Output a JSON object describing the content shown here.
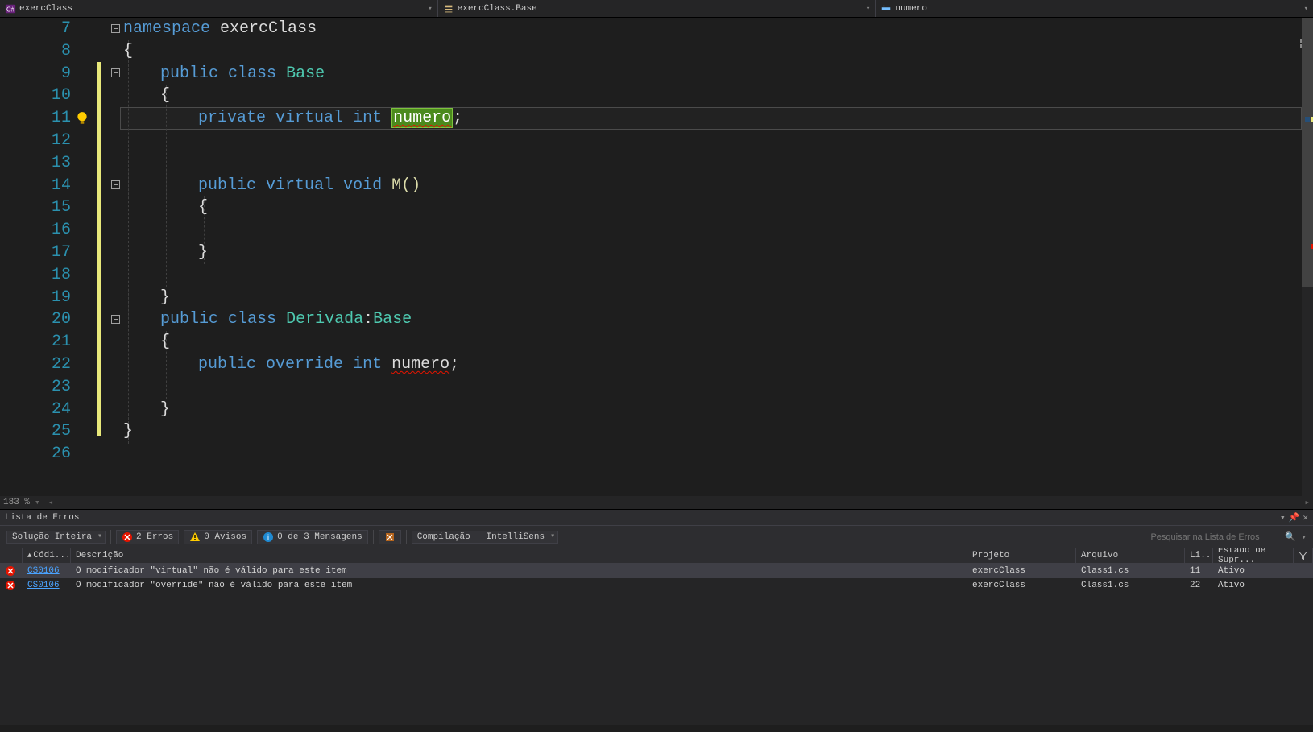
{
  "context_bar": {
    "scope": "exercClass",
    "class": "exercClass.Base",
    "member": "numero"
  },
  "zoom": "183 %",
  "code": {
    "lines": [
      {
        "n": 7
      },
      {
        "n": 8
      },
      {
        "n": 9
      },
      {
        "n": 10
      },
      {
        "n": 11
      },
      {
        "n": 12
      },
      {
        "n": 13
      },
      {
        "n": 14
      },
      {
        "n": 15
      },
      {
        "n": 16
      },
      {
        "n": 17
      },
      {
        "n": 18
      },
      {
        "n": 19
      },
      {
        "n": 20
      },
      {
        "n": 21
      },
      {
        "n": 22
      },
      {
        "n": 23
      },
      {
        "n": 24
      },
      {
        "n": 25
      },
      {
        "n": 26
      }
    ],
    "tokens": {
      "namespace": "namespace",
      "exercClass": "exercClass",
      "ob": "{",
      "cb": "}",
      "public": "public",
      "class": "class",
      "Base": "Base",
      "private": "private",
      "virtual": "virtual",
      "int": "int",
      "numero": "numero",
      "semi": ";",
      "void": "void",
      "M": "M()",
      "override": "override",
      "Derivada": "Derivada",
      "colon": ":"
    }
  },
  "error_panel": {
    "title": "Lista de Erros",
    "scope_combo": "Solução Inteira",
    "err_chip": "2 Erros",
    "warn_chip": "0 Avisos",
    "msg_chip": "0 de 3 Mensagens",
    "build_combo": "Compilação + IntelliSens",
    "search_placeholder": "Pesquisar na Lista de Erros",
    "columns": {
      "c1": "Códi...",
      "c2": "Descrição",
      "c3": "Projeto",
      "c4": "Arquivo",
      "c5": "Li...",
      "c6": "Estado de Supr..."
    },
    "rows": [
      {
        "code": "CS0106",
        "desc": "O modificador \"virtual\" não é válido para este item",
        "proj": "exercClass",
        "file": "Class1.cs",
        "line": "11",
        "state": "Ativo"
      },
      {
        "code": "CS0106",
        "desc": "O modificador \"override\" não é válido para este item",
        "proj": "exercClass",
        "file": "Class1.cs",
        "line": "22",
        "state": "Ativo"
      }
    ]
  }
}
